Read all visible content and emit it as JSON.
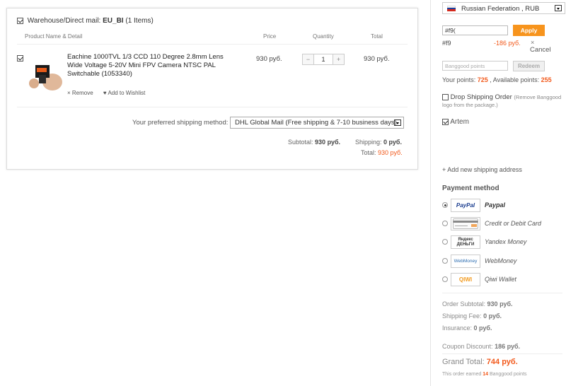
{
  "cart": {
    "warehouse_label": "Warehouse/Direct mail:",
    "warehouse_name": "EU_BI",
    "items_count": "(1 Items)",
    "columns": {
      "product": "Product Name & Detail",
      "price": "Price",
      "quantity": "Quantity",
      "total": "Total"
    },
    "item": {
      "name": "Eachine 1000TVL 1/3 CCD 110 Degree 2.8mm Lens Wide Voltage 5-20V Mini FPV Camera NTSC PAL Switchable (1053340)",
      "price": "930 руб.",
      "quantity": "1",
      "total": "930 руб.",
      "remove_label": "× Remove",
      "wishlist_label": "♥ Add to Wishlist"
    },
    "shipping_label": "Your preferred shipping method:",
    "shipping_value": "DHL Global Mail (Free shipping & 7-10 business days)",
    "subtotal_label": "Subtotal:",
    "subtotal_value": "930 руб.",
    "shipping_cost_label": "Shipping:",
    "shipping_cost_value": "0 руб.",
    "total_label": "Total:",
    "total_value": "930 руб."
  },
  "sidebar": {
    "country": "Russian Federation , RUB",
    "coupon_value": "#f9(",
    "apply_label": "Apply",
    "applied_code": "#f9",
    "applied_discount": "-186 руб.",
    "cancel_x": "×",
    "cancel_label": "Cancel",
    "points_placeholder": "Banggood points",
    "redeem_label": "Redeem",
    "your_points_label": "Your points:",
    "your_points_value": "725",
    "available_points_label": ", Available points:",
    "available_points_value": "255",
    "drop_shipping_label": "Drop Shipping Order",
    "drop_shipping_note": "(Remove Banggood logo from the package.)",
    "address_name": "Artem",
    "add_address_label": "+ Add new shipping address",
    "payment_title": "Payment method",
    "payment_methods": [
      {
        "label": "Paypal",
        "logo": "PayPal"
      },
      {
        "label": "Credit or Debit Card",
        "logo": "card"
      },
      {
        "label": "Yandex Money",
        "logo": "Яндекс ДЕНЬГИ"
      },
      {
        "label": "WebMoney",
        "logo": "WebMoney"
      },
      {
        "label": "Qiwi Wallet",
        "logo": "QIWI"
      }
    ],
    "order_subtotal_label": "Order Subtotal:",
    "order_subtotal_value": "930 руб.",
    "shipping_fee_label": "Shipping Fee:",
    "shipping_fee_value": "0 руб.",
    "insurance_label": "Insurance:",
    "insurance_value": "0 руб.",
    "coupon_discount_label": "Coupon Discount:",
    "coupon_discount_value": "186 руб.",
    "grand_total_label": "Grand Total:",
    "grand_total_value": "744 руб.",
    "earned_prefix": "This order earned",
    "earned_value": "14",
    "earned_suffix": "Banggood points"
  },
  "colors": {
    "accent_orange": "#f2591b",
    "apply_button": "#f7941d"
  }
}
